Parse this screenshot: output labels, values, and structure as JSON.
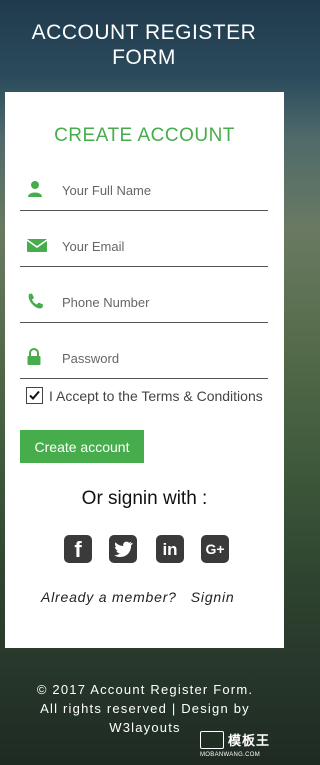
{
  "page": {
    "title_line1": "ACCOUNT REGISTER",
    "title_line2": "FORM"
  },
  "form": {
    "heading": "CREATE ACCOUNT",
    "fields": [
      {
        "icon": "user-icon",
        "placeholder": "Your Full Name",
        "value": ""
      },
      {
        "icon": "envelope-icon",
        "placeholder": "Your Email",
        "value": ""
      },
      {
        "icon": "phone-icon",
        "placeholder": "Phone Number",
        "value": ""
      },
      {
        "icon": "lock-icon",
        "placeholder": "Password",
        "value": ""
      }
    ],
    "terms_label": "I Accept to the Terms & Conditions",
    "terms_checked": true,
    "submit_label": "Create account",
    "or_signin": "Or signin with :",
    "socials": [
      {
        "icon": "facebook-icon",
        "glyph": "f"
      },
      {
        "icon": "twitter-icon",
        "glyph": "t"
      },
      {
        "icon": "linkedin-icon",
        "glyph": "in"
      },
      {
        "icon": "google-plus-icon",
        "glyph": "G+"
      }
    ],
    "already_member": "Already a member?",
    "signin_link": "Signin"
  },
  "footer": {
    "line1": "© 2017 Account Register Form.",
    "line2": "All rights reserved | Design by",
    "line3": "W3layouts"
  },
  "watermark": {
    "text": "模板王",
    "sub": "MOBANWANG.COM"
  },
  "colors": {
    "accent": "#47ad4c",
    "icon_dark": "#3a3a3a",
    "card": "#ffffff"
  }
}
